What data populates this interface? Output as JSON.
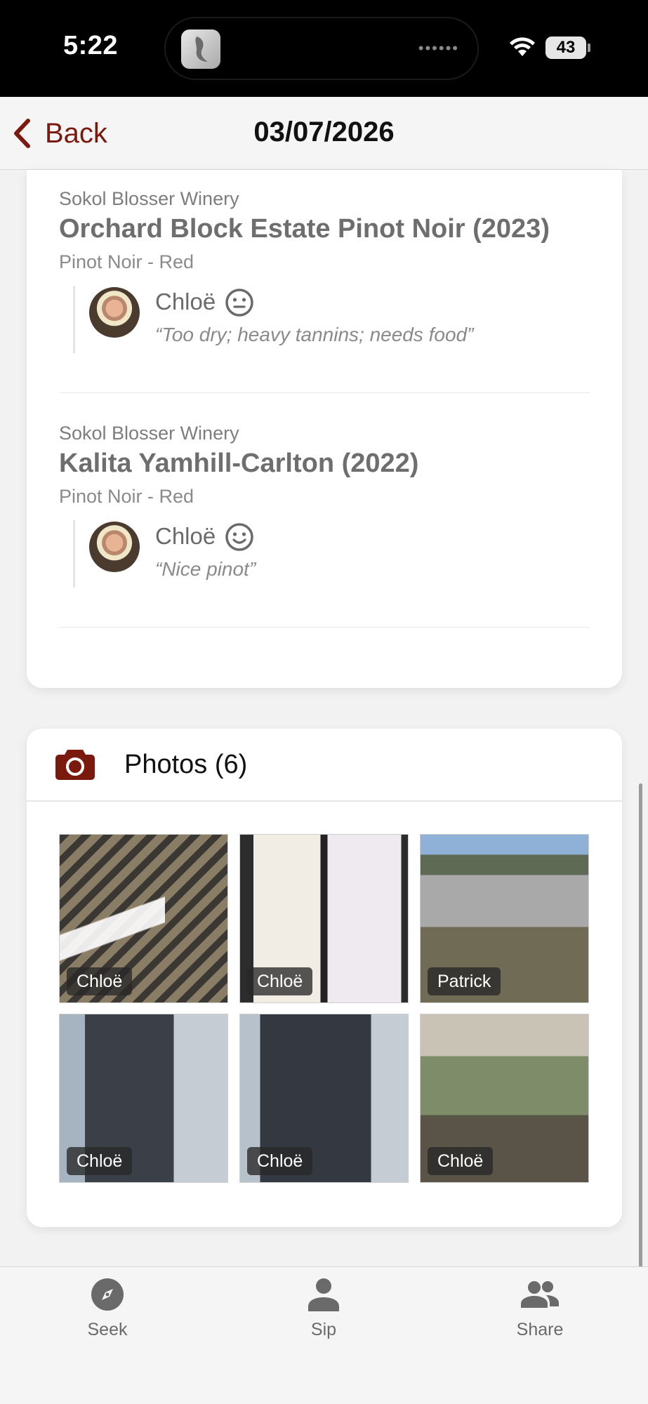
{
  "status_bar": {
    "time": "5:22",
    "battery": "43"
  },
  "nav": {
    "back_label": "Back",
    "title": "03/07/2026"
  },
  "wines": [
    {
      "winery": "Sokol Blosser Winery",
      "name": "Orchard Block Estate Pinot Noir (2023)",
      "varietal": "Pinot Noir - Red",
      "review": {
        "reviewer": "Chloë",
        "mood": "neutral-face-icon",
        "text": "“Too dry; heavy tannins; needs food”"
      }
    },
    {
      "winery": "Sokol Blosser Winery",
      "name": "Kalita Yamhill-Carlton (2022)",
      "varietal": "Pinot Noir - Red",
      "review": {
        "reviewer": "Chloë",
        "mood": "smile-face-icon",
        "text": "“Nice pinot”"
      }
    }
  ],
  "photos": {
    "title": "Photos (6)",
    "items": [
      {
        "author": "Chloë"
      },
      {
        "author": "Chloë"
      },
      {
        "author": "Patrick"
      },
      {
        "author": "Chloë"
      },
      {
        "author": "Chloë"
      },
      {
        "author": "Chloë"
      }
    ]
  },
  "tabs": [
    {
      "label": "Seek",
      "icon": "compass-icon"
    },
    {
      "label": "Sip",
      "icon": "person-icon"
    },
    {
      "label": "Share",
      "icon": "people-icon"
    }
  ],
  "colors": {
    "accent": "#7a1a0e",
    "camera": "#7a1a0e"
  }
}
